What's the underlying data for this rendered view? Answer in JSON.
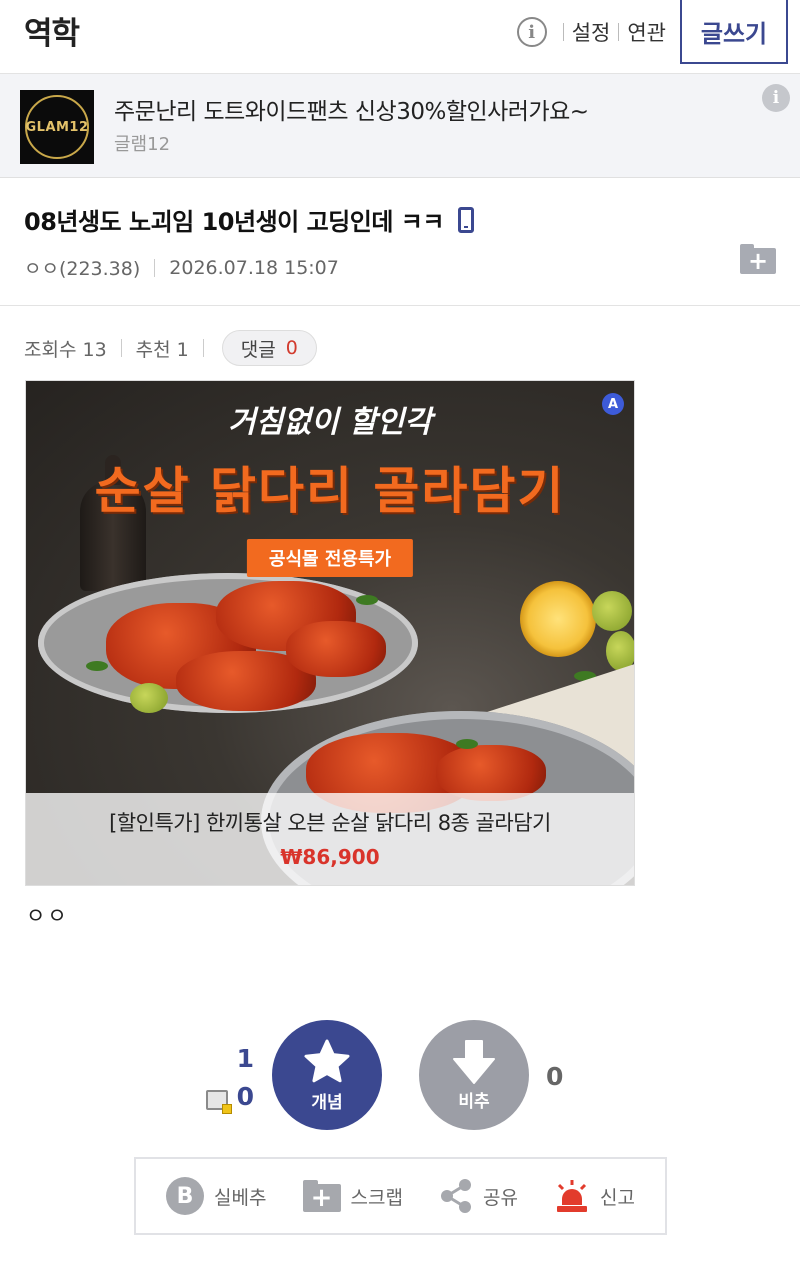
{
  "header": {
    "gallery_title": "역학",
    "info_glyph": "i",
    "settings_label": "설정",
    "related_label": "연관",
    "write_label": "글쓰기"
  },
  "ad_banner": {
    "logo_text": "GLAM12",
    "text": "주문난리 도트와이드팬츠 신상30%할인사러가요~",
    "advertiser": "글램12",
    "info_glyph": "i"
  },
  "post": {
    "title": "08년생도 노괴임 10년생이 고딩인데 ㅋㅋ",
    "author": "ㅇㅇ(223.38)",
    "date": "2026.07.18 15:07",
    "views_label": "조회수 13",
    "recommend_label": "추천 1",
    "comments_label": "댓글",
    "comments_count": "0",
    "body": "ㅇㅇ"
  },
  "ad_image": {
    "badge": "A",
    "slogan": "거침없이 할인각",
    "headline": "순살 닭다리 골라담기",
    "pill": "공식몰 전용특가",
    "caption": "[할인특가] 한끼통살 오븐 순살 닭다리 8종 골라담기",
    "price": "₩86,900",
    "accent_color": "#f26a1f",
    "price_color": "#d9342b"
  },
  "vote": {
    "up_count": "1",
    "fixed_count": "0",
    "up_label": "개념",
    "down_label": "비추",
    "down_count": "0",
    "up_color": "#3b4890",
    "down_color": "#9c9ea6"
  },
  "actions": {
    "best_label": "실베추",
    "best_glyph": "B",
    "scrap_label": "스크랩",
    "share_label": "공유",
    "report_label": "신고"
  },
  "icons": [
    "info-icon",
    "mobile-icon",
    "folder-add-icon",
    "star-icon",
    "down-arrow-icon",
    "fix-icon",
    "b-icon",
    "scrap-icon",
    "share-icon",
    "siren-icon"
  ]
}
